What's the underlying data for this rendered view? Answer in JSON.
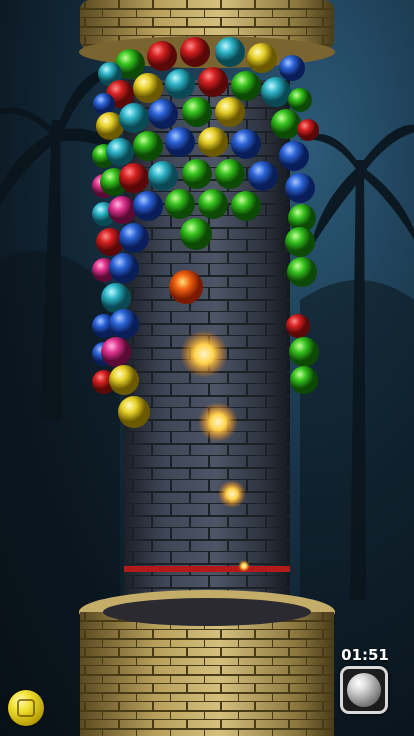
{
  "game": {
    "timer": "01:51",
    "current_ball_color": "yellow",
    "powerup": "bomb-ball",
    "palette": {
      "red": "#d42020",
      "yellow": "#e8d12a",
      "green": "#35c21e",
      "cyan": "#2fb6c8",
      "blue": "#2c64d8",
      "pink": "#e0338f",
      "stone": "#3b4250",
      "sandstone": "#c9b26e"
    }
  }
}
